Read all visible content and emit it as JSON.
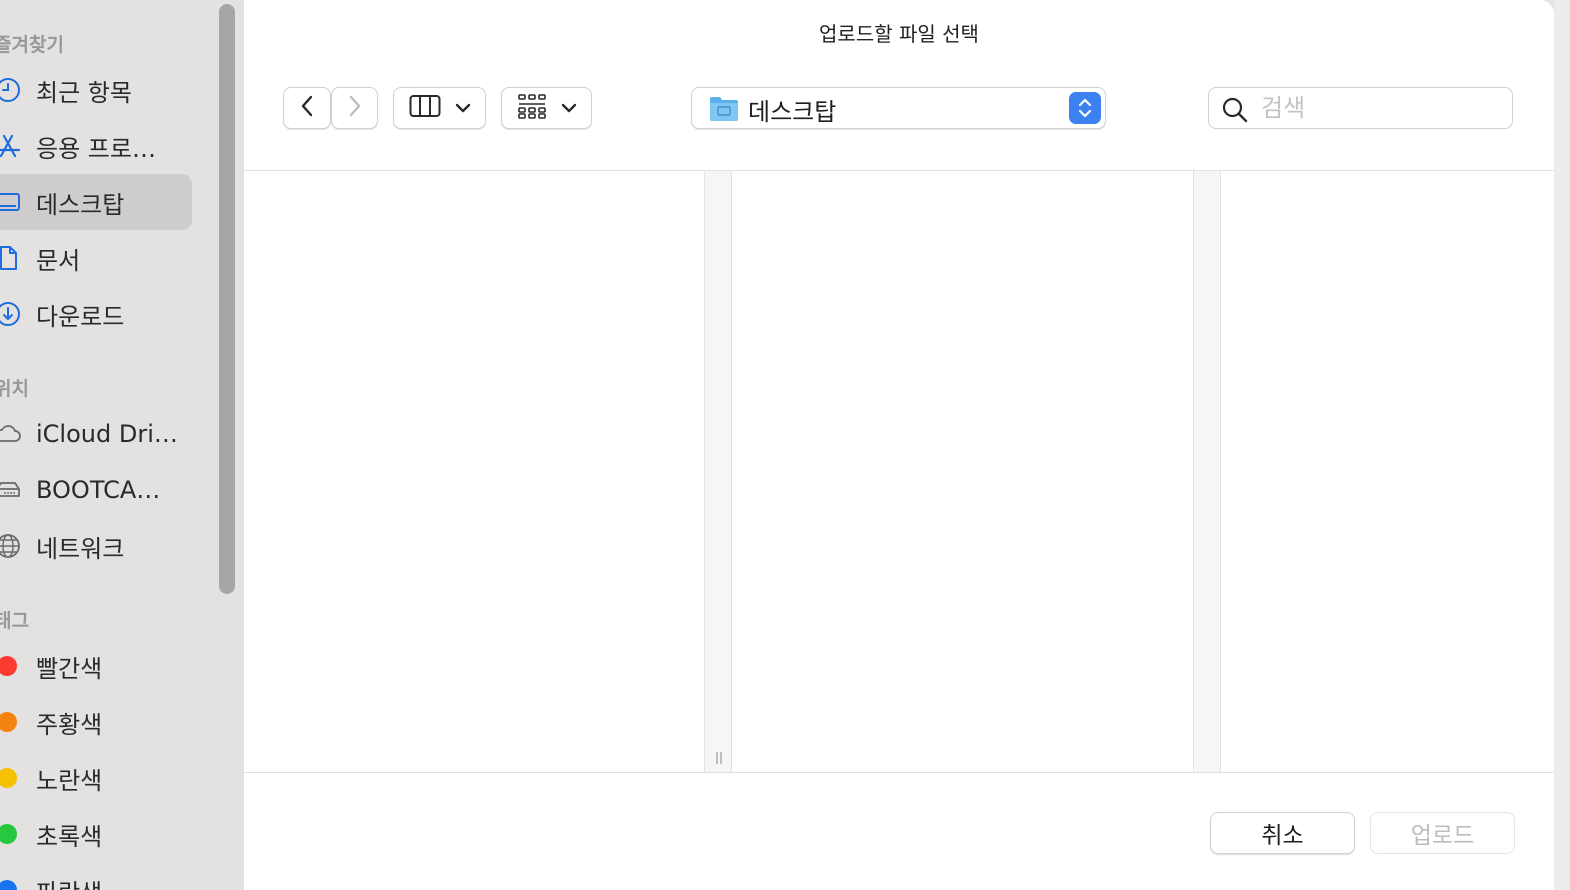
{
  "window": {
    "title": "업로드할 파일 선택"
  },
  "sidebar": {
    "sections": {
      "favorites": "즐겨찾기",
      "locations": "위치",
      "tags": "태그"
    },
    "favorites": [
      {
        "label": "최근 항목",
        "icon": "clock-icon"
      },
      {
        "label": "응용 프로…",
        "icon": "app-store-icon"
      },
      {
        "label": "데스크탑",
        "icon": "desktop-icon",
        "selected": true
      },
      {
        "label": "문서",
        "icon": "document-icon"
      },
      {
        "label": "다운로드",
        "icon": "download-icon"
      }
    ],
    "locations": [
      {
        "label": "iCloud Dri…",
        "icon": "cloud-icon"
      },
      {
        "label": "BOOTCA…",
        "icon": "drive-icon"
      },
      {
        "label": "네트워크",
        "icon": "globe-icon"
      }
    ],
    "tags": [
      {
        "label": "빨간색",
        "color": "#fb3b2f"
      },
      {
        "label": "주황색",
        "color": "#f5830f"
      },
      {
        "label": "노란색",
        "color": "#f4c105"
      },
      {
        "label": "초록색",
        "color": "#27c83f"
      },
      {
        "label": "파란색",
        "color": "#1a73f0"
      }
    ]
  },
  "toolbar": {
    "back": "chevron-left-icon",
    "forward": "chevron-right-icon",
    "view_mode": "columns-view-icon",
    "group_mode": "grid-group-icon",
    "path": {
      "label": "데스크탑",
      "icon": "folder-icon"
    },
    "search": {
      "placeholder": "검색",
      "value": ""
    }
  },
  "footer": {
    "cancel_label": "취소",
    "upload_label": "업로드"
  },
  "colors": {
    "accent": "#3b82f0",
    "sidebar_bg": "#e4e2e0",
    "sidebar_selected": "#cfcdcb",
    "icon_blue": "#1e6ce0"
  }
}
